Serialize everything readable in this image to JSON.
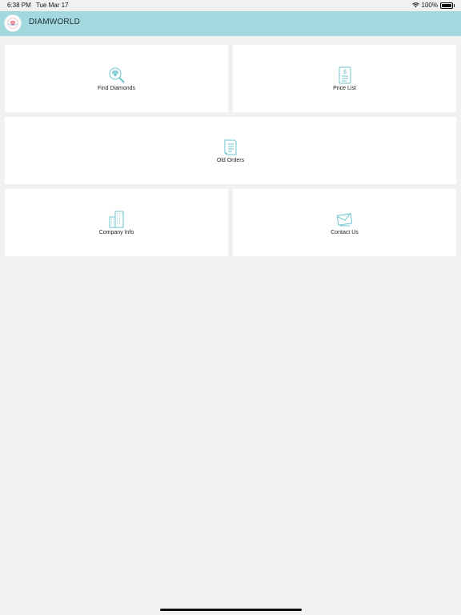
{
  "status": {
    "time": "6:38 PM",
    "date": "Tue Mar 17",
    "battery": "100%",
    "wifi_icon": "wifi-icon",
    "battery_level": 1.0
  },
  "header": {
    "title": "DIAMWORLD",
    "logo_icon": "brand-logo"
  },
  "tiles": [
    {
      "label": "Find Diamonds",
      "icon": "diamond-search-icon"
    },
    {
      "label": "Price List",
      "icon": "price-list-icon"
    },
    {
      "label": "Old Orders",
      "icon": "document-icon"
    },
    {
      "label": "Company Info",
      "icon": "building-icon"
    },
    {
      "label": "Contact Us",
      "icon": "envelope-icon"
    }
  ],
  "colors": {
    "accent": "#a3d9de",
    "icon": "#6cc3cb",
    "background": "#f1f1f1",
    "tile": "#ffffff"
  }
}
